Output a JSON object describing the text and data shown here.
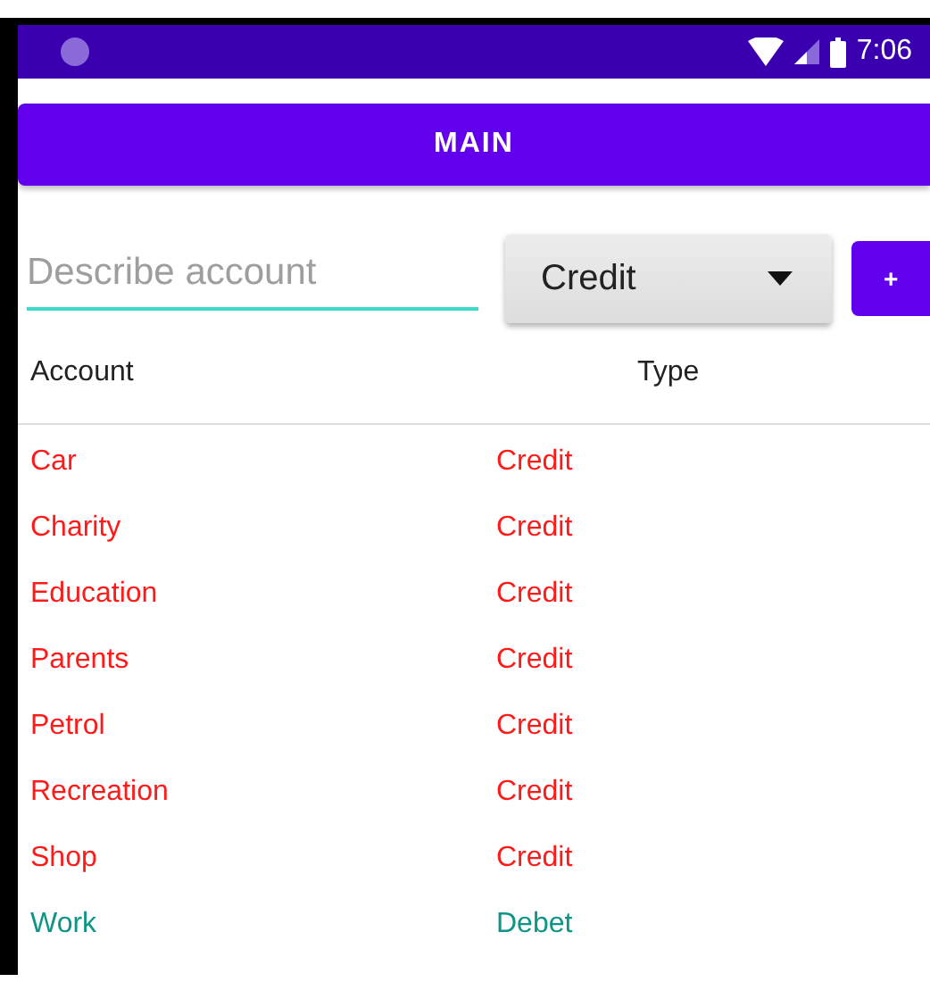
{
  "status_bar": {
    "time": "7:06"
  },
  "main_button": "MAIN",
  "account_field": {
    "placeholder": "Describe account"
  },
  "type_dropdown": {
    "value": "Credit"
  },
  "add_button": "+",
  "table": {
    "columns": [
      "Account",
      "Type"
    ],
    "rows": [
      {
        "account": "Car",
        "type": "Credit",
        "color": "#ff1a1a"
      },
      {
        "account": "Charity",
        "type": "Credit",
        "color": "#ff1a1a"
      },
      {
        "account": "Education",
        "type": "Credit",
        "color": "#ff1a1a"
      },
      {
        "account": "Parents",
        "type": "Credit",
        "color": "#ff1a1a"
      },
      {
        "account": "Petrol",
        "type": "Credit",
        "color": "#ff1a1a"
      },
      {
        "account": "Recreation",
        "type": "Credit",
        "color": "#ff1a1a"
      },
      {
        "account": "Shop",
        "type": "Credit",
        "color": "#ff1a1a"
      },
      {
        "account": "Work",
        "type": "Debet",
        "color": "#0f9488"
      }
    ]
  }
}
